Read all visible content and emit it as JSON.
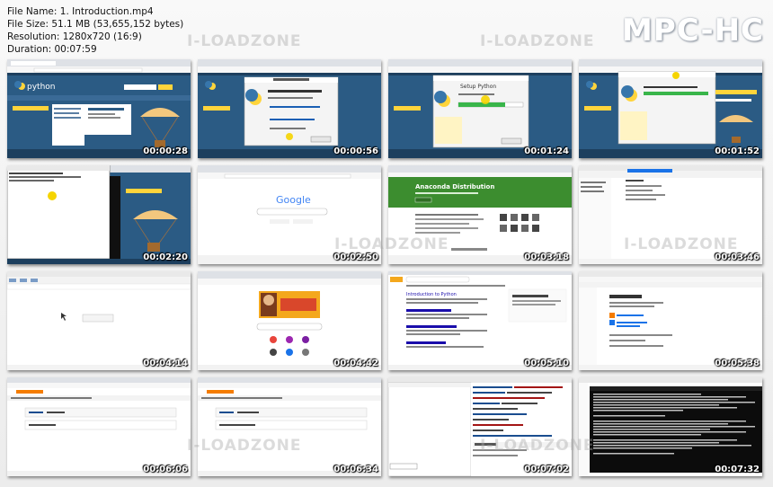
{
  "info": {
    "file_name": "File Name: 1. Introduction.mp4",
    "file_size": "File Size: 51.1 MB (53,655,152 bytes)",
    "resolution": "Resolution: 1280x720 (16:9)",
    "duration": "Duration: 00:07:59"
  },
  "brand": "MPC-HC",
  "watermark": "I-LOADZONE",
  "thumbnails": [
    {
      "time": "00:00:28",
      "scene": "python-download"
    },
    {
      "time": "00:00:56",
      "scene": "python-setup-dialog"
    },
    {
      "time": "00:01:24",
      "scene": "python-setup-progress"
    },
    {
      "time": "00:01:52",
      "scene": "python-setup-complete"
    },
    {
      "time": "00:02:20",
      "scene": "python-window-overlay"
    },
    {
      "time": "00:02:50",
      "scene": "google-search"
    },
    {
      "time": "00:03:18",
      "scene": "anaconda-distribution"
    },
    {
      "time": "00:03:46",
      "scene": "file-explorer"
    },
    {
      "time": "00:04:14",
      "scene": "blank-app"
    },
    {
      "time": "00:04:42",
      "scene": "google-doodle"
    },
    {
      "time": "00:05:10",
      "scene": "search-results"
    },
    {
      "time": "00:05:38",
      "scene": "jupyter-notebook"
    },
    {
      "time": "00:06:06",
      "scene": "notebook-cell"
    },
    {
      "time": "00:06:34",
      "scene": "notebook-cell-2"
    },
    {
      "time": "00:07:02",
      "scene": "code-editor"
    },
    {
      "time": "00:07:32",
      "scene": "command-prompt"
    }
  ],
  "text": {
    "google_logo": "Google",
    "anaconda_title": "Anaconda Distribution",
    "python_logo": "python",
    "setup_title": "Setup Python",
    "download_heading": "Download",
    "search_heading": "Introduction to Python"
  },
  "colors": {
    "python_blue": "#2b5b84",
    "python_dark": "#1d3f5e",
    "anaconda_green": "#3c8d2f",
    "chrome_gray": "#dee1e6",
    "cmd_black": "#0c0c0c",
    "cursor_yellow": "#f5d400"
  }
}
